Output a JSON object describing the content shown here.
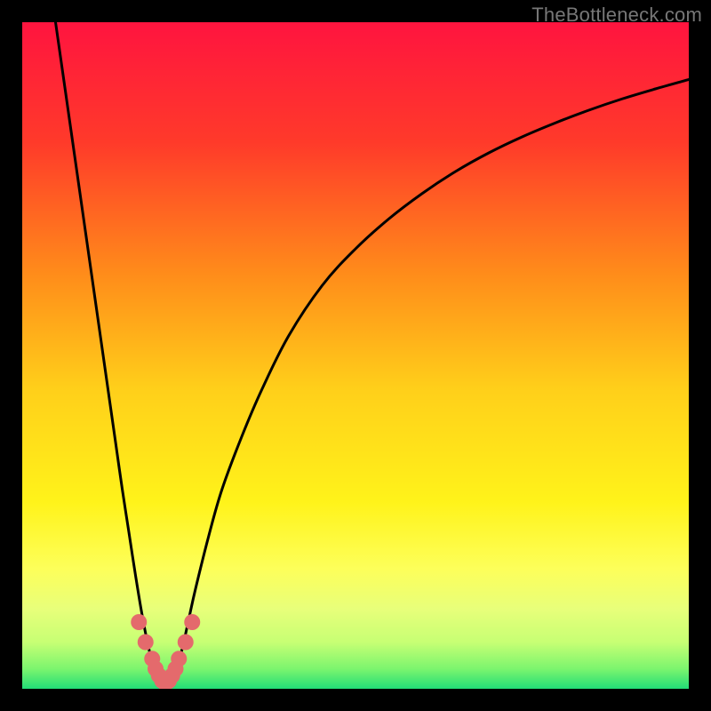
{
  "watermark": "TheBottleneck.com",
  "chart_data": {
    "type": "line",
    "title": "",
    "xlabel": "",
    "ylabel": "",
    "xlim": [
      0,
      100
    ],
    "ylim": [
      0,
      100
    ],
    "grid": false,
    "background_gradient_stops": [
      {
        "offset": 0.0,
        "color": "#ff143f"
      },
      {
        "offset": 0.18,
        "color": "#ff3a2a"
      },
      {
        "offset": 0.38,
        "color": "#ff8d1a"
      },
      {
        "offset": 0.55,
        "color": "#ffcf1a"
      },
      {
        "offset": 0.72,
        "color": "#fff31a"
      },
      {
        "offset": 0.82,
        "color": "#fdff5a"
      },
      {
        "offset": 0.88,
        "color": "#e8ff7a"
      },
      {
        "offset": 0.93,
        "color": "#c7ff74"
      },
      {
        "offset": 0.97,
        "color": "#7cf56e"
      },
      {
        "offset": 1.0,
        "color": "#22dd77"
      }
    ],
    "series": [
      {
        "name": "bottleneck-curve",
        "color": "#000000",
        "stroke_width": 3,
        "x": [
          5,
          6,
          7,
          8,
          9,
          10,
          11,
          12,
          13,
          14,
          15,
          16,
          17,
          18,
          19,
          20,
          21,
          22,
          23,
          24,
          25,
          26,
          28,
          30,
          33,
          36,
          40,
          45,
          50,
          55,
          60,
          65,
          70,
          75,
          80,
          85,
          90,
          95,
          100
        ],
        "y": [
          100,
          93,
          86,
          79,
          72,
          65,
          58,
          51,
          44,
          37,
          30,
          23.5,
          17,
          11,
          6,
          2.5,
          0.3,
          0.3,
          2.5,
          6,
          10.5,
          15,
          23,
          30,
          38,
          45,
          53,
          60.5,
          66,
          70.5,
          74.3,
          77.6,
          80.4,
          82.8,
          84.9,
          86.8,
          88.5,
          90,
          91.4
        ]
      }
    ],
    "markers": {
      "name": "trough-markers",
      "color": "#e46a6c",
      "radius": 9,
      "x": [
        17.5,
        18.5,
        19.5,
        20.0,
        20.5,
        21.0,
        21.5,
        22.0,
        22.5,
        23.0,
        23.5,
        24.5,
        25.5
      ],
      "y": [
        10.0,
        7.0,
        4.5,
        3.0,
        2.0,
        1.2,
        0.8,
        1.2,
        2.0,
        3.0,
        4.5,
        7.0,
        10.0
      ]
    }
  }
}
